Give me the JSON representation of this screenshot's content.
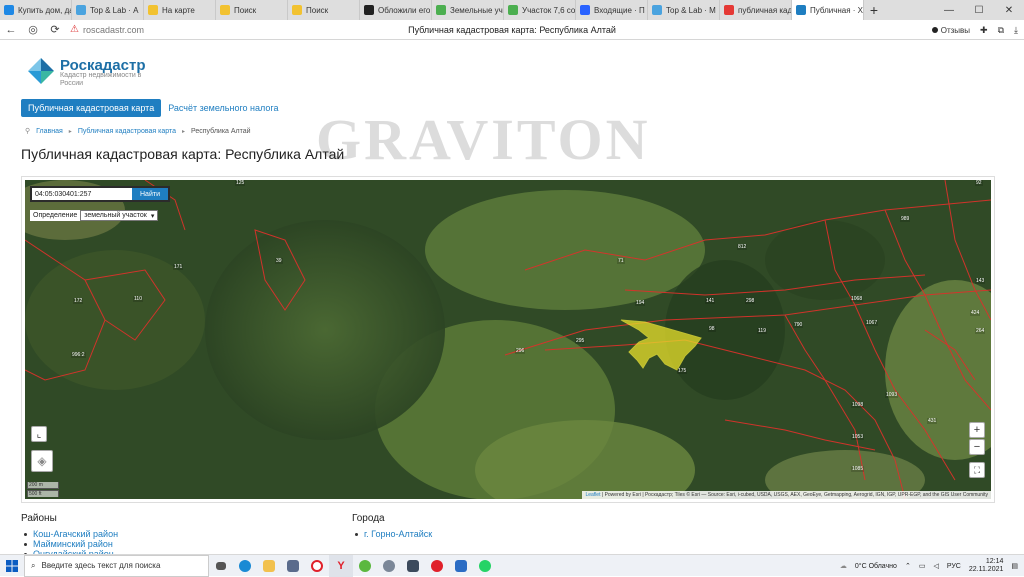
{
  "browser": {
    "tabs": [
      {
        "label": "Купить дом, да",
        "color": "#1e88e5"
      },
      {
        "label": "Top & Lab · А",
        "color": "#4aa3df"
      },
      {
        "label": "На карте",
        "color": "#f2c230"
      },
      {
        "label": "Поиск",
        "color": "#f2c230"
      },
      {
        "label": "Поиск",
        "color": "#f2c230"
      },
      {
        "label": "Обложили его",
        "color": "#222222"
      },
      {
        "label": "Земельные уч",
        "color": "#4caf50"
      },
      {
        "label": "Участок 7,6 со",
        "color": "#4caf50"
      },
      {
        "label": "Входящие · П",
        "color": "#2962ff"
      },
      {
        "label": "Top & Lab · М",
        "color": "#4aa3df"
      },
      {
        "label": "публичная кад",
        "color": "#e53935"
      },
      {
        "label": "Публичная · Х",
        "color": "#1f7ec1"
      }
    ],
    "url": "roscadastr.com",
    "page_title": "Публичная кадастровая карта: Республика Алтай",
    "feedback_label": "Отзывы"
  },
  "site": {
    "brand": "Роскадастр",
    "brand_sub": "Кадастр недвижимости в России",
    "nav": {
      "active": "Публичная кадастровая карта",
      "link": "Расчёт земельного налога"
    },
    "breadcrumb": [
      "Главная",
      "Публичная кадастровая карта",
      "Республика Алтай"
    ],
    "watermark": "GRAVITON",
    "heading": "Публичная кадастровая карта: Республика Алтай"
  },
  "map": {
    "search_value": "04:05:030401:257",
    "search_button": "Найти",
    "definition_label": "Определение",
    "definition_value": "земельный участок",
    "zoom_in": "+",
    "zoom_out": "−",
    "scale_m": "200 m",
    "scale_ft": "500 ft",
    "attribution_leaflet": "Leaflet",
    "attribution_text": "| Powered by Esri | Роскадастр; Tiles © Esri — Source: Esri, i-cubed, USDA, USGS, AEX, GeoEye, Getmapping, Aerogrid, IGN, IGP, UPR-EGP, and the GIS User Community",
    "plot_labels": [
      "125",
      "171",
      "172",
      "110",
      "39",
      "996:2",
      "194",
      "141",
      "98",
      "295",
      "92",
      "119",
      "790",
      "1068",
      "175",
      "1067",
      "1085",
      "1098",
      "1053",
      "431",
      "989",
      "812",
      "1093",
      "264",
      "71",
      "296",
      "298",
      "143",
      "424"
    ],
    "highlight_color": "#e8e02a",
    "boundary_color": "#d9322b"
  },
  "lists": {
    "regions_title": "Районы",
    "regions": [
      "Кош-Агачский район",
      "Майминский район",
      "Онгудайский район"
    ],
    "cities_title": "Города",
    "cities": [
      "г. Горно-Алтайск"
    ]
  },
  "taskbar": {
    "search_placeholder": "Введите здесь текст для поиска",
    "weather": "0°C Облачно",
    "lang": "РУС",
    "time": "12:14",
    "date": "22.11.2021"
  }
}
